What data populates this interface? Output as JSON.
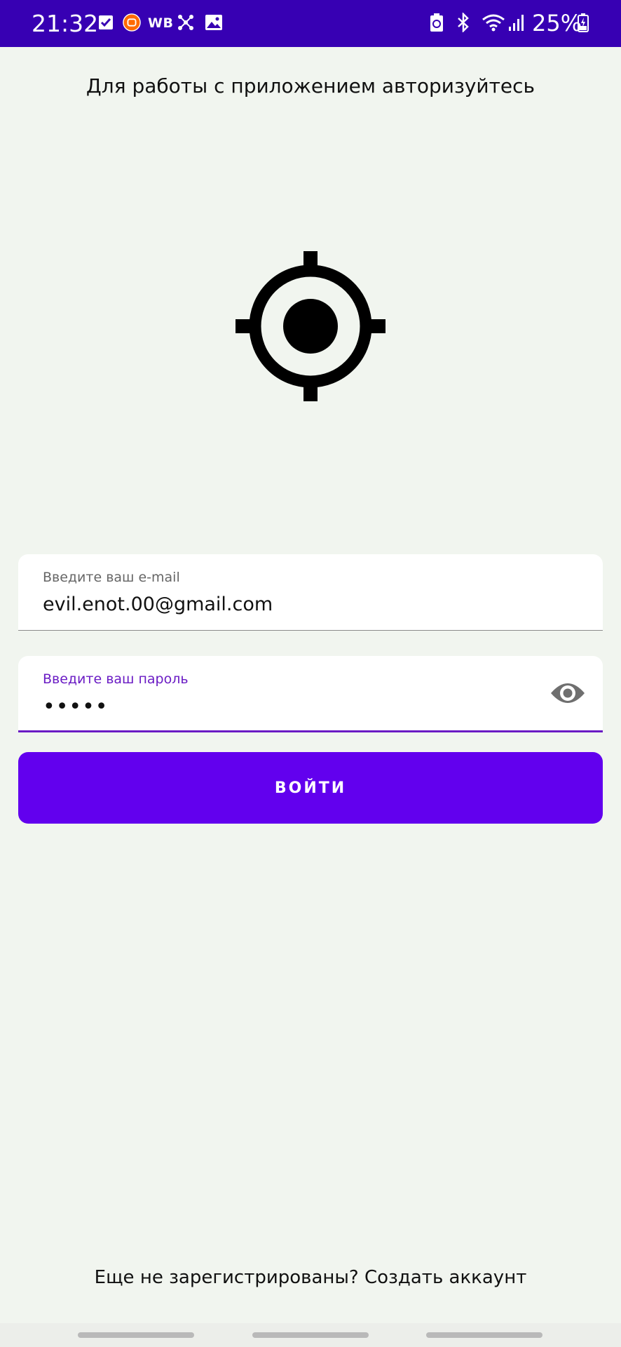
{
  "status_bar": {
    "time": "21:32",
    "notif_wb": "WB",
    "battery_percent": "25%",
    "icons": [
      "check-square-icon",
      "xiaomi-app-icon",
      "wb-label",
      "snowflake-icon",
      "image-icon",
      "battery-saver-icon",
      "bluetooth-icon",
      "wifi-icon",
      "signal-icon",
      "battery-charging-icon"
    ],
    "background": "#3700b3"
  },
  "header": {
    "title": "Для работы с приложением авторизуйтесь"
  },
  "logo": {
    "icon": "crosshair-target-icon"
  },
  "form": {
    "email": {
      "label": "Введите ваш e-mail",
      "value": "evil.enot.00@gmail.com"
    },
    "password": {
      "label": "Введите ваш пароль",
      "value": "•••••",
      "toggle_icon": "eye-icon"
    },
    "submit_label": "ВОЙТИ"
  },
  "footer": {
    "prompt": "Еще не зарегистрированы?",
    "link": "Создать аккаунт"
  },
  "colors": {
    "accent": "#6200ee",
    "focus": "#6a1bc4",
    "background": "#f1f5ef"
  }
}
